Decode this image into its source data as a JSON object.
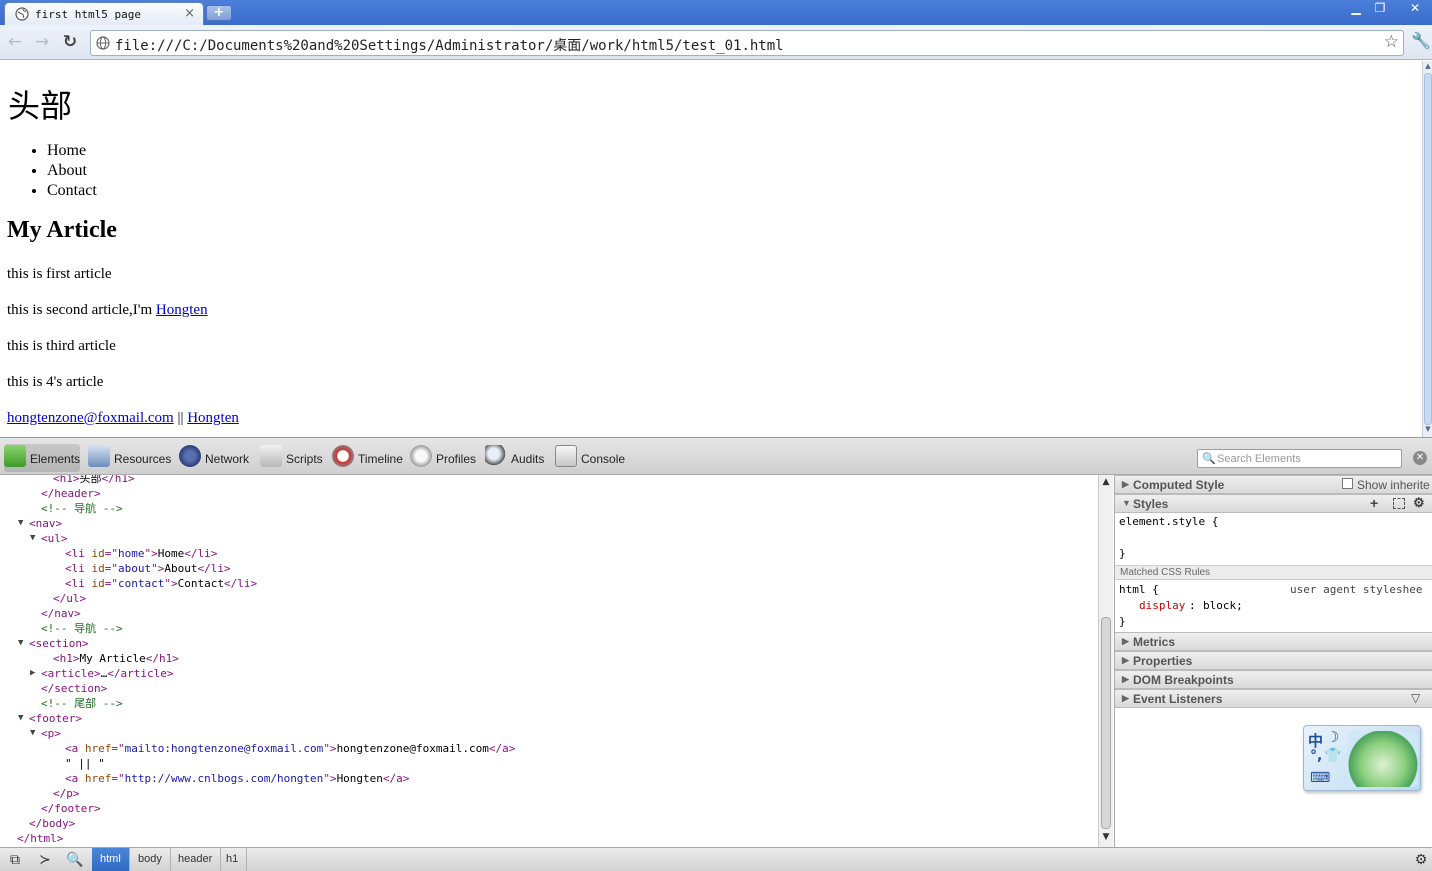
{
  "browser": {
    "tab_title": "first html5 page",
    "tab_close": "×",
    "new_tab": "+",
    "url": "file:///C:/Documents%20and%20Settings/Administrator/桌面/work/html5/test_01.html",
    "win_minimize": "▁",
    "win_restore": "❐",
    "win_close": "✕"
  },
  "page": {
    "header_h1": "头部",
    "nav_items": [
      "Home",
      "About",
      "Contact"
    ],
    "section_h1": "My Article",
    "p1": "this is first article",
    "p2_text": "this is second article,I'm ",
    "p2_link": "Hongten",
    "p3": "this is third article",
    "p4": "this is 4's article",
    "footer_email": "hongtenzone@foxmail.com",
    "footer_sep": " || ",
    "footer_link": "Hongten"
  },
  "devtools": {
    "tabs": [
      "Elements",
      "Resources",
      "Network",
      "Scripts",
      "Timeline",
      "Profiles",
      "Audits",
      "Console"
    ],
    "selected_tab": "Elements",
    "search_placeholder": "Search Elements",
    "tree_lines": [
      {
        "indent": 4,
        "html": "<span class='tg'>&lt;h1&gt;</span><span class='tx'>头部</span><span class='tg'>&lt;/h1&gt;</span>"
      },
      {
        "indent": 3,
        "html": "<span class='tg'>&lt;/header&gt;</span>"
      },
      {
        "indent": 3,
        "html": "<span class='cm'>&lt;!-- 导航 --&gt;</span>"
      },
      {
        "indent": 2,
        "arrow": "▼",
        "html": "<span class='tg'>&lt;nav&gt;</span>"
      },
      {
        "indent": 3,
        "arrow": "▼",
        "html": "<span class='tg'>&lt;ul&gt;</span>"
      },
      {
        "indent": 5,
        "html": "<span class='tg'>&lt;li </span><span class='at'>id</span><span class='tg'>=\"</span><span class='av'>home</span><span class='tg'>\"&gt;</span><span class='tx'>Home</span><span class='tg'>&lt;/li&gt;</span>"
      },
      {
        "indent": 5,
        "html": "<span class='tg'>&lt;li </span><span class='at'>id</span><span class='tg'>=\"</span><span class='av'>about</span><span class='tg'>\"&gt;</span><span class='tx'>About</span><span class='tg'>&lt;/li&gt;</span>"
      },
      {
        "indent": 5,
        "html": "<span class='tg'>&lt;li </span><span class='at'>id</span><span class='tg'>=\"</span><span class='av'>contact</span><span class='tg'>\"&gt;</span><span class='tx'>Contact</span><span class='tg'>&lt;/li&gt;</span>"
      },
      {
        "indent": 4,
        "html": "<span class='tg'>&lt;/ul&gt;</span>"
      },
      {
        "indent": 3,
        "html": "<span class='tg'>&lt;/nav&gt;</span>"
      },
      {
        "indent": 3,
        "html": "<span class='cm'>&lt;!-- 导航 --&gt;</span>"
      },
      {
        "indent": 2,
        "arrow": "▼",
        "html": "<span class='tg'>&lt;section&gt;</span>"
      },
      {
        "indent": 4,
        "html": "<span class='tg'>&lt;h1&gt;</span><span class='tx'>My Article</span><span class='tg'>&lt;/h1&gt;</span>"
      },
      {
        "indent": 3,
        "arrow": "▶",
        "html": "<span class='tg'>&lt;article&gt;</span><span class='tx'>…</span><span class='tg'>&lt;/article&gt;</span>"
      },
      {
        "indent": 3,
        "html": "<span class='tg'>&lt;/section&gt;</span>"
      },
      {
        "indent": 3,
        "html": "<span class='cm'>&lt;!-- 尾部 --&gt;</span>"
      },
      {
        "indent": 2,
        "arrow": "▼",
        "html": "<span class='tg'>&lt;footer&gt;</span>"
      },
      {
        "indent": 3,
        "arrow": "▼",
        "html": "<span class='tg'>&lt;p&gt;</span>"
      },
      {
        "indent": 5,
        "html": "<span class='tg'>&lt;a </span><span class='at'>href</span><span class='tg'>=\"</span><span class='av'>mailto:hongtenzone@foxmail.com</span><span class='tg'>\"&gt;</span><span class='tx'>hongtenzone@foxmail.com</span><span class='tg'>&lt;/a&gt;</span>"
      },
      {
        "indent": 5,
        "html": "<span class='tx'>\" || \"</span>"
      },
      {
        "indent": 5,
        "html": "<span class='tg'>&lt;a </span><span class='at'>href</span><span class='tg'>=\"</span><span class='av'>http://www.cnlbogs.com/hongten</span><span class='tg'>\"&gt;</span><span class='tx'>Hongten</span><span class='tg'>&lt;/a&gt;</span>"
      },
      {
        "indent": 4,
        "html": "<span class='tg'>&lt;/p&gt;</span>"
      },
      {
        "indent": 3,
        "html": "<span class='tg'>&lt;/footer&gt;</span>"
      },
      {
        "indent": 2,
        "html": "<span class='tg'>&lt;/body&gt;</span>"
      },
      {
        "indent": 1,
        "html": "<span class='tg'>&lt;/html&gt;</span>"
      }
    ],
    "sidebar": {
      "computed_style": "Computed Style",
      "show_inherited": "Show inherite",
      "styles": "Styles",
      "element_style": "element.style {",
      "close_brace": "}",
      "matched_rules": "Matched CSS Rules",
      "rule_selector": "html {",
      "rule_origin": "user agent styleshee",
      "rule_prop": "display",
      "rule_val": "block;",
      "metrics": "Metrics",
      "properties": "Properties",
      "dom_breakpoints": "DOM Breakpoints",
      "event_listeners": "Event Listeners"
    },
    "breadcrumbs": [
      "html",
      "body",
      "header",
      "h1"
    ],
    "selected_crumb": "html"
  },
  "ime": {
    "zh": "中",
    "moon": "☽",
    "dots": "°,",
    "shirt": "👕",
    "kb": "⌨"
  },
  "colors": {
    "link": "#0000cc",
    "tag": "#881280",
    "attr": "#994500",
    "attr_value": "#1a1aa6",
    "comment": "#236e25",
    "crumb_selected": "#2f69c1"
  }
}
